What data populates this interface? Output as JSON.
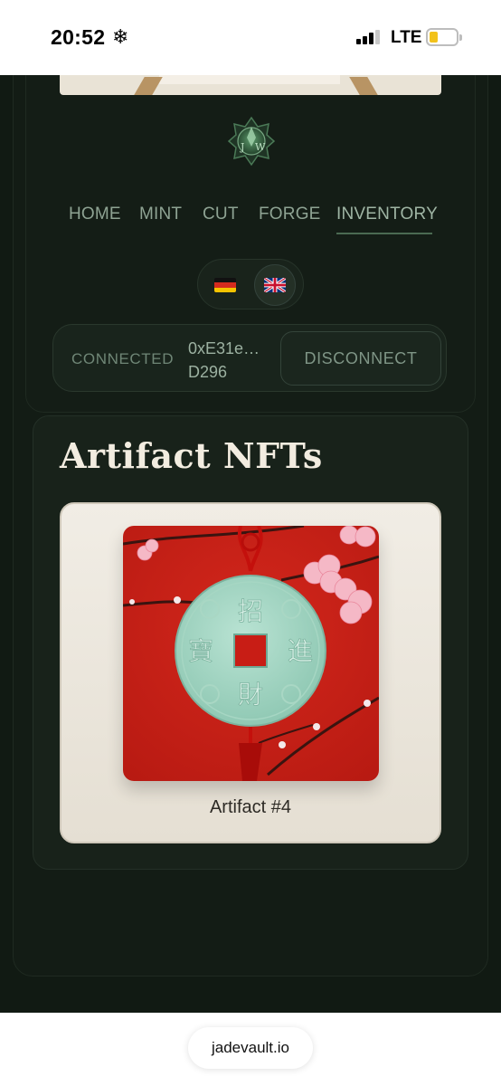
{
  "status_bar": {
    "time": "20:52",
    "network": "LTE",
    "battery_level": 0.2,
    "signal_bars": 3
  },
  "logo": {
    "text": "JW"
  },
  "nav": {
    "items": [
      {
        "label": "HOME"
      },
      {
        "label": "MINT"
      },
      {
        "label": "CUT"
      },
      {
        "label": "FORGE"
      },
      {
        "label": "INVENTORY"
      }
    ],
    "active": "INVENTORY"
  },
  "languages": [
    {
      "flag": "de-flag",
      "active": false
    },
    {
      "flag": "uk-flag",
      "active": true
    }
  ],
  "wallet": {
    "status": "CONNECTED",
    "address_line1": "0xE31e…",
    "address_line2": "D296",
    "disconnect_label": "DISCONNECT"
  },
  "inventory": {
    "title": "Artifact NFTs",
    "items": [
      {
        "name": "Artifact #4",
        "image": "jade-coin-artifact-image"
      }
    ]
  },
  "browser": {
    "url": "jadevault.io"
  },
  "colors": {
    "background": "#111a13",
    "accent": "#9fb5a4",
    "card": "#eee9df"
  }
}
